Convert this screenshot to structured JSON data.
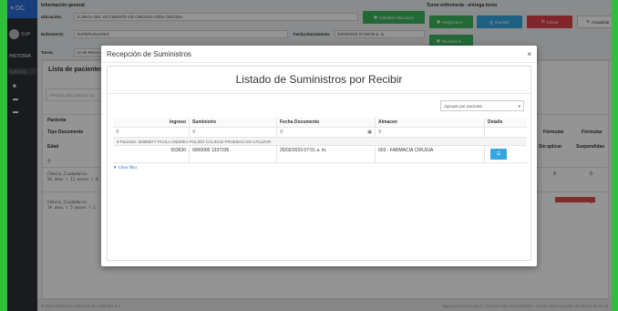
{
  "sidebar": {
    "brand": "≡ DC",
    "user": "SUP",
    "history": "HISTORIA",
    "search_placeholder": "Q  Busca",
    "icons": [
      "home-icon",
      "folder-icon",
      "folder-icon"
    ]
  },
  "header": {
    "info_title": "Información general",
    "turno_title": "Turno enfermería - entrega turno",
    "ubicacion_label": "Ubicación:",
    "ubicacion_value": "CLINICA DEL OCCIDENTE-CE-CIRUGIA-CR01-CIRUGIA",
    "cambiar_button": "Cambiar Ubicación",
    "enfermero_label": "Enfermer@:",
    "enfermero_value": "SUPERUSUARIO",
    "fecha_label": "Fecha Documento:",
    "fecha_value": "22/03/2023 07:00:00 a. m.",
    "turno_label": "Turno:",
    "turno_value": "22 de Marzo d",
    "registrar_button": "Registrar e...",
    "imprimir_button": "Imprimir",
    "cerrar_button": "Cerrar",
    "actualizar_button": "Actualizar",
    "recepcion_button": "Recepción ..."
  },
  "background": {
    "list_title": "Lista de pacientes",
    "search_placeholder": "Arrastre una columna aq",
    "col_paciente": "Paciente",
    "col_tipo": "Tipo Documento",
    "col_edad": "Edad",
    "row1": "Cédula_Ciudadanía\n56 años \\ 11 meses \\ 8",
    "row2": "Cédula_Ciudadanía\n39 años \\ 5 meses \\ 1",
    "col_formulas": "Fórmulas",
    "col_formulas2": "Fórmulas",
    "col_sin_aplicar": "Sin aplicar",
    "col_suspendidas": "Suspendidas",
    "zero": "0",
    "footer_left": "© 2023 Sistemas y Asesorías de Colombia S.A.",
    "footer_right": "dgampasa18 (Usuario). | CLINICA DEL OCCIDENTE - Versión 2023 Upgrade 35 Parche 21.07.26"
  },
  "modal": {
    "title": "Recepción de Suministros",
    "close": "×",
    "heading": "Listado de Suministros por Recibir",
    "group_select": "Agrupar por paciente",
    "columns": [
      "Ingreso",
      "Suministro",
      "Fecha Documento",
      "Almacen",
      "Detalle"
    ],
    "group_label": "Paciente: 52985877 PAULA ANDREA PULIDO CALIDAD PRUEBAS NO UTILIZAR",
    "row": {
      "ingreso": "553630",
      "suministro": "0000000 1337235",
      "fecha": "25/02/2023 07:01 a. m.",
      "almacen": "003 - FARMACIA CIRUGIA"
    },
    "clear_filter": "Clear filtro"
  }
}
